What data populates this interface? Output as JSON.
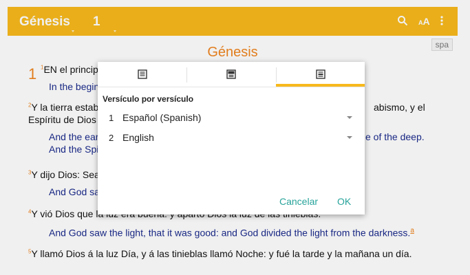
{
  "appbar": {
    "book": "Génesis",
    "chapter": "1",
    "icons": [
      "search-icon",
      "text-size-icon",
      "more-vert-icon"
    ],
    "color": "#f8b91c"
  },
  "content": {
    "language_badge": "spa",
    "title": "Génesis",
    "chapter_number": "1",
    "verses": [
      {
        "num": "1",
        "es": "EN el princip",
        "en": "In the begin"
      },
      {
        "num": "2",
        "es": "Y la tierra estab",
        "es_right": "abismo, y el",
        "es2": "Espíritu de Dios",
        "en": "And the ear",
        "en_right": "e of the deep.",
        "en2": "And the Spi"
      },
      {
        "num": "3",
        "es": "Y dijo Dios: Sea",
        "en": "And God sa"
      },
      {
        "num": "4",
        "es": "Y vió Dios que la luz era buena: y apartó Dios la luz de las tinieblas.",
        "en": "And God saw the light, that it was good: and God divided the light from the darkness.",
        "note": "a"
      },
      {
        "num": "5",
        "es": "Y llamó Dios á la luz Día, y á las tinieblas llamó Noche: y fué la tarde y la mañana un día."
      }
    ],
    "accent_color": "#f0851f",
    "english_color": "#1a2a8c"
  },
  "dialog": {
    "tabs": [
      {
        "icon": "single-layout-icon",
        "selected": false
      },
      {
        "icon": "split-layout-icon",
        "selected": false
      },
      {
        "icon": "verse-by-verse-icon",
        "selected": true
      }
    ],
    "heading": "Versículo por versículo",
    "rows": [
      {
        "num": "1",
        "language": "Español (Spanish)"
      },
      {
        "num": "2",
        "language": "English"
      }
    ],
    "cancel": "Cancelar",
    "ok": "OK",
    "button_color": "#27a39a"
  }
}
